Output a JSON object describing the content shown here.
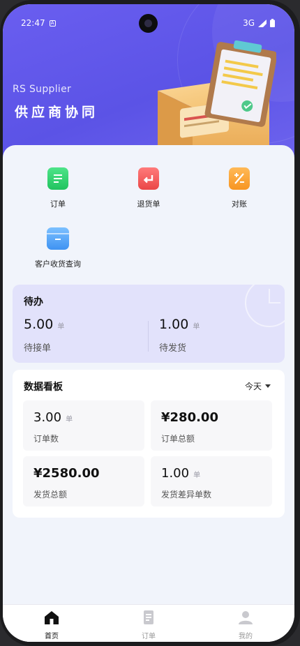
{
  "status_bar": {
    "time": "22:47",
    "network": "3G"
  },
  "brand": {
    "subtitle": "RS Supplier",
    "title": "供应商协同"
  },
  "shortcuts": [
    {
      "label": "订单",
      "icon": "document-icon",
      "color": "#2fd26b"
    },
    {
      "label": "退货单",
      "icon": "return-icon",
      "color": "#f05a5a"
    },
    {
      "label": "对账",
      "icon": "reconcile-icon",
      "color": "#f8a33a"
    },
    {
      "label": "客户收货查询",
      "icon": "box-icon",
      "color": "#4aa0f8"
    }
  ],
  "todo": {
    "title": "待办",
    "items": [
      {
        "value": "5.00",
        "unit": "单",
        "caption": "待接单"
      },
      {
        "value": "1.00",
        "unit": "单",
        "caption": "待发货"
      }
    ]
  },
  "dashboard": {
    "title": "数据看板",
    "filter": "今天",
    "tiles": [
      {
        "value": "3.00",
        "unit": "单",
        "caption": "订单数"
      },
      {
        "value": "¥280.00",
        "unit": "",
        "caption": "订单总额"
      },
      {
        "value": "¥2580.00",
        "unit": "",
        "caption": "发货总额"
      },
      {
        "value": "1.00",
        "unit": "单",
        "caption": "发货差异单数"
      }
    ]
  },
  "tabbar": [
    {
      "label": "首页",
      "icon": "home-icon",
      "active": true
    },
    {
      "label": "订单",
      "icon": "order-icon",
      "active": false
    },
    {
      "label": "我的",
      "icon": "profile-icon",
      "active": false
    }
  ],
  "colors": {
    "accent": "#5b53e6",
    "todo_bg": "#e2e2fb",
    "page_bg": "#f1f4fb"
  }
}
